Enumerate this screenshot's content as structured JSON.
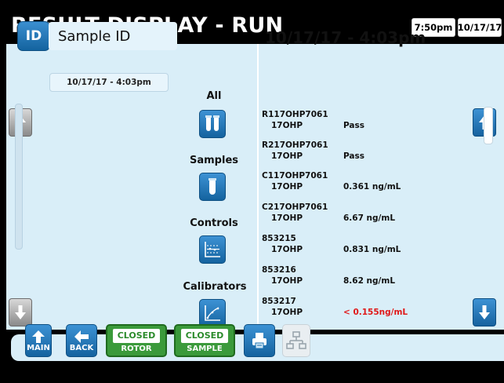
{
  "header": {
    "title": "RESULT DISPLAY - RUN",
    "time": "7:50pm",
    "date": "10/17/17"
  },
  "left": {
    "id_badge": "ID",
    "sample_id_label": "Sample ID",
    "run_date_time": "10/17/17 - 4:03pm"
  },
  "filters": [
    {
      "label": "All",
      "icon": "tubes-icon"
    },
    {
      "label": "Samples",
      "icon": "tube-icon"
    },
    {
      "label": "Controls",
      "icon": "controls-chart-icon"
    },
    {
      "label": "Calibrators",
      "icon": "calibration-curve-icon"
    }
  ],
  "detail": {
    "date_time": "10/17/17 - 4:03pm",
    "results": [
      {
        "id": "R117OHP7061",
        "analyte": "17OHP",
        "value": "Pass",
        "flag": false
      },
      {
        "id": "R217OHP7061",
        "analyte": "17OHP",
        "value": "Pass",
        "flag": false
      },
      {
        "id": "C117OHP7061",
        "analyte": "17OHP",
        "value": "0.361 ng/mL",
        "flag": false
      },
      {
        "id": "C217OHP7061",
        "analyte": "17OHP",
        "value": "6.67 ng/mL",
        "flag": false
      },
      {
        "id": "853215",
        "analyte": "17OHP",
        "value": "0.831 ng/mL",
        "flag": false
      },
      {
        "id": "853216",
        "analyte": "17OHP",
        "value": "8.62 ng/mL",
        "flag": false
      },
      {
        "id": "853217",
        "analyte": "17OHP",
        "value": "< 0.155ng/mL",
        "flag": true
      }
    ]
  },
  "bottom": {
    "main_label": "MAIN",
    "back_label": "BACK",
    "rotor_status": "CLOSED",
    "rotor_label": "ROTOR",
    "sample_status": "CLOSED",
    "sample_label": "SAMPLE"
  },
  "colors": {
    "accent_blue": "#1a70b0",
    "panel_bg": "#d9eef8",
    "status_green": "#3b9a3b",
    "flag_red": "#e01818"
  }
}
